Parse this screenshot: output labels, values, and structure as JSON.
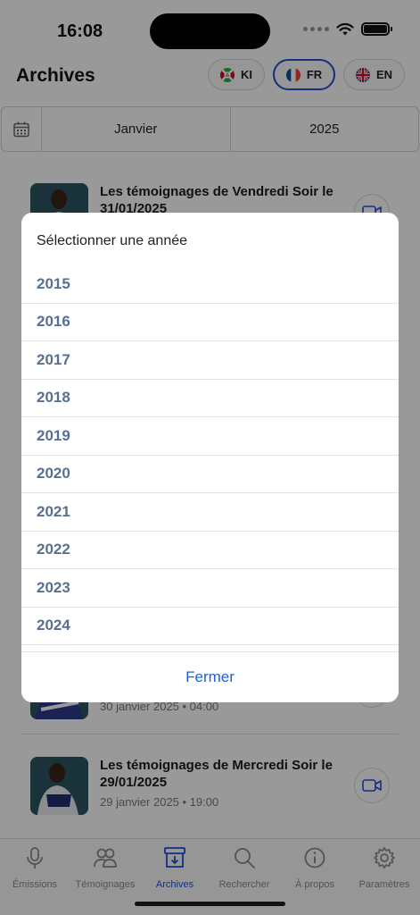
{
  "status": {
    "time": "16:08"
  },
  "header": {
    "title": "Archives"
  },
  "languages": [
    {
      "code": "KI",
      "active": false
    },
    {
      "code": "FR",
      "active": true
    },
    {
      "code": "EN",
      "active": false
    }
  ],
  "date_filter": {
    "month": "Janvier",
    "year": "2025"
  },
  "episodes": [
    {
      "title": "Les témoignages de Vendredi Soir le 31/01/2025",
      "meta": ""
    },
    {
      "title": "",
      "meta": "30 janvier 2025 • 04:00"
    },
    {
      "title": "Les témoignages de Mercredi Soir le 29/01/2025",
      "meta": "29 janvier 2025 • 19:00"
    }
  ],
  "tabs": [
    {
      "label": "Émissions",
      "icon": "microphone-icon"
    },
    {
      "label": "Témoignages",
      "icon": "people-icon"
    },
    {
      "label": "Archives",
      "icon": "archive-icon",
      "active": true
    },
    {
      "label": "Rechercher",
      "icon": "search-icon"
    },
    {
      "label": "À propos",
      "icon": "info-icon"
    },
    {
      "label": "Paramètres",
      "icon": "gear-icon"
    }
  ],
  "modal": {
    "title": "Sélectionner une année",
    "years": [
      "2015",
      "2016",
      "2017",
      "2018",
      "2019",
      "2020",
      "2021",
      "2022",
      "2023",
      "2024"
    ],
    "close_label": "Fermer"
  },
  "colors": {
    "accent": "#1e4fd8",
    "year_text": "#58708f"
  }
}
